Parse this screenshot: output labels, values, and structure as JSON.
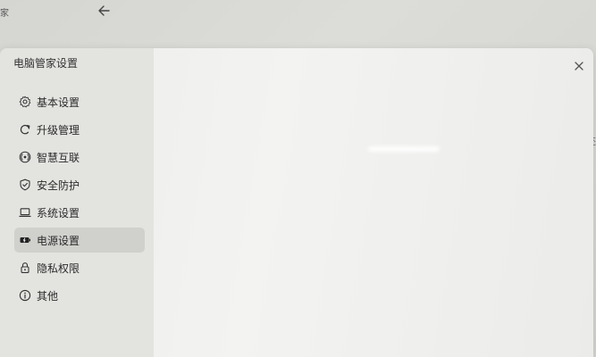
{
  "background": {
    "label": "家",
    "edge_text": "还"
  },
  "dialog": {
    "title": "电脑管家设置"
  },
  "menu": {
    "items": [
      {
        "label": "基本设置",
        "icon": "gear-icon"
      },
      {
        "label": "升级管理",
        "icon": "refresh-icon"
      },
      {
        "label": "智慧互联",
        "icon": "connect-icon"
      },
      {
        "label": "安全防护",
        "icon": "shield-icon"
      },
      {
        "label": "系统设置",
        "icon": "laptop-icon"
      },
      {
        "label": "电源设置",
        "icon": "battery-icon",
        "active": true
      },
      {
        "label": "隐私权限",
        "icon": "lock-icon"
      },
      {
        "label": "其他",
        "icon": "info-icon"
      }
    ]
  }
}
